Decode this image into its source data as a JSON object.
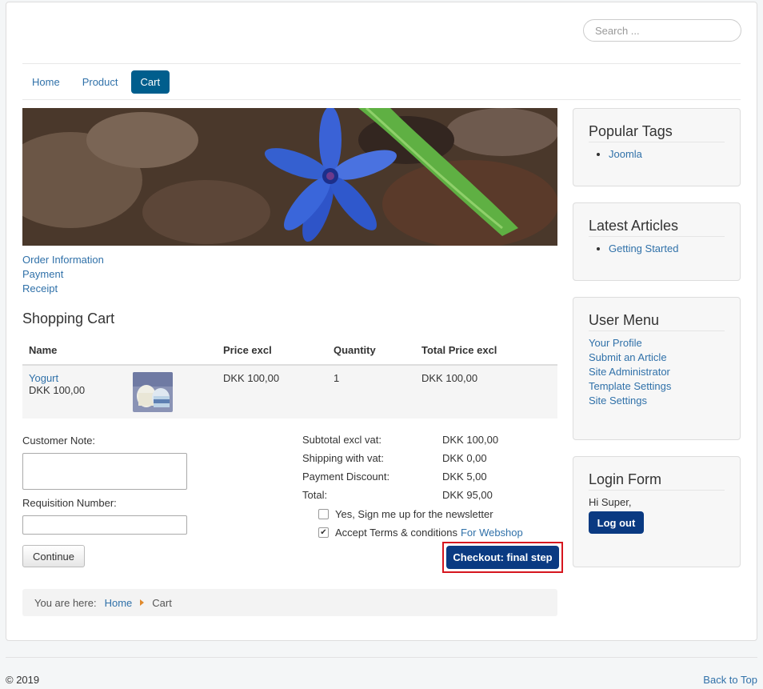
{
  "search": {
    "placeholder": "Search ..."
  },
  "nav": [
    {
      "label": "Home"
    },
    {
      "label": "Product"
    },
    {
      "label": "Cart"
    }
  ],
  "steps": [
    "Order Information",
    "Payment",
    "Receipt"
  ],
  "cart": {
    "title": "Shopping Cart",
    "columns": [
      "Name",
      "Price excl",
      "Quantity",
      "Total Price excl"
    ],
    "rows": [
      {
        "name": "Yogurt",
        "unit_price": "DKK 100,00",
        "price": "DKK 100,00",
        "quantity": "1",
        "total": "DKK 100,00"
      }
    ]
  },
  "form": {
    "note_label": "Customer Note:",
    "requisition_label": "Requisition Number:",
    "continue_label": "Continue"
  },
  "totals": [
    {
      "label": "Subtotal excl vat:",
      "value": "DKK 100,00"
    },
    {
      "label": "Shipping with vat:",
      "value": "DKK 0,00"
    },
    {
      "label": "Payment Discount:",
      "value": "DKK 5,00"
    },
    {
      "label": "Total:",
      "value": "DKK 95,00"
    }
  ],
  "newsletter": {
    "label": "Yes, Sign me up for the newsletter",
    "checked": false
  },
  "terms": {
    "label": "Accept Terms & conditions",
    "link": "For Webshop",
    "checked": true
  },
  "checkout_label": "Checkout: final step",
  "breadcrumb": {
    "prefix": "You are here:",
    "home": "Home",
    "current": "Cart"
  },
  "sidebar": {
    "popular_tags": {
      "title": "Popular Tags",
      "items": [
        "Joomla"
      ]
    },
    "latest_articles": {
      "title": "Latest Articles",
      "items": [
        "Getting Started"
      ]
    },
    "user_menu": {
      "title": "User Menu",
      "items": [
        "Your Profile",
        "Submit an Article",
        "Site Administrator",
        "Template Settings",
        "Site Settings"
      ]
    },
    "login": {
      "title": "Login Form",
      "greeting": "Hi Super,",
      "logout_label": "Log out"
    }
  },
  "footer": {
    "copyright": "© 2019",
    "back_to_top": "Back to Top"
  },
  "colors": {
    "link": "#3071a9",
    "nav_active": "#005e8d",
    "primary_button": "#0a3a82",
    "highlight_border": "#d6161e"
  }
}
